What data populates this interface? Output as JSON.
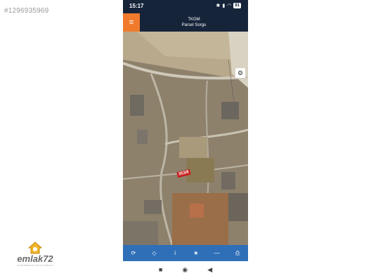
{
  "watermark": {
    "id_text": "#1296935969"
  },
  "brand": {
    "name": "emlak72",
    "tagline": "GAYRIMENKUL SATIŞ PORTALI"
  },
  "statusbar": {
    "time": "15:17",
    "battery": "81",
    "icons": [
      "bluetooth-icon",
      "signal-icon",
      "wifi-icon"
    ]
  },
  "appbar": {
    "title": "TKGM",
    "subtitle": "Parsel Sorgu",
    "menu_icon": "≡"
  },
  "map": {
    "parcel_label": "353/8",
    "settings_icon": "⚙"
  },
  "toolbar": {
    "items": [
      {
        "name": "refresh",
        "glyph": "⟳"
      },
      {
        "name": "locate",
        "glyph": "◇"
      },
      {
        "name": "info",
        "glyph": "i"
      },
      {
        "name": "favorite",
        "glyph": "★"
      },
      {
        "name": "measure",
        "glyph": "—"
      },
      {
        "name": "print",
        "glyph": "⎙"
      }
    ]
  },
  "navbar": {
    "recent": "■",
    "home": "◉",
    "back": "◀"
  },
  "colors": {
    "header": "#16243a",
    "menu": "#f07a2c",
    "toolbar": "#2f6fb8",
    "parcel": "#c81e1e"
  }
}
